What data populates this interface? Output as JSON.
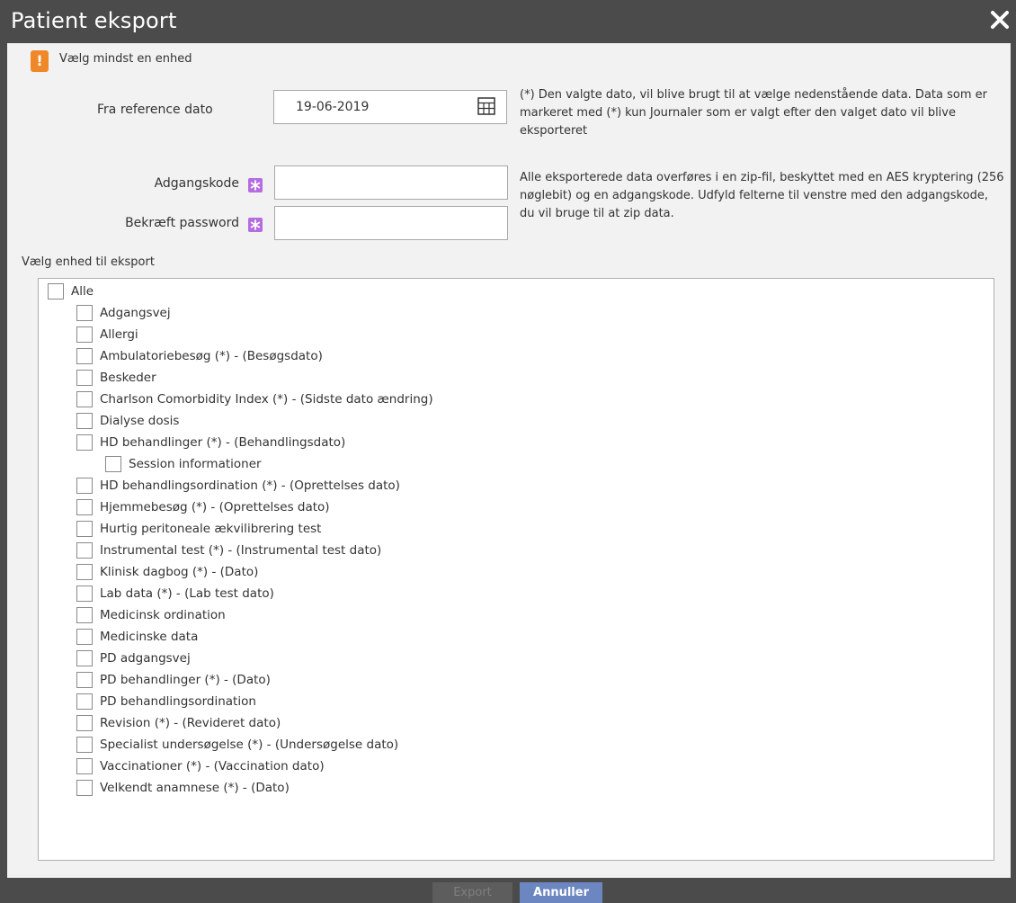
{
  "window": {
    "title": "Patient eksport"
  },
  "warning": {
    "text": "Vælg mindst en enhed"
  },
  "form": {
    "date_label": "Fra reference dato",
    "date_value": "19-06-2019",
    "date_help": "(*) Den valgte dato, vil blive brugt til at vælge nedenstående data. Data som er markeret med (*)  kun Journaler som er valgt efter den valget dato vil blive eksporteret",
    "password_label": "Adgangskode",
    "confirm_label": "Bekræft password",
    "password_help": "Alle eksporterede data overføres i en zip-fil, beskyttet med en AES kryptering (256 nøglebit) og en adgangskode. Udfyld felterne til venstre med den adgangskode, du vil bruge til at zip data."
  },
  "section_label": "Vælg enhed til eksport",
  "list": {
    "all": "Alle",
    "items": [
      "Adgangsvej",
      "Allergi",
      "Ambulatoriebesøg (*) - (Besøgsdato)",
      "Beskeder",
      "Charlson Comorbidity Index (*) - (Sidste dato ændring)",
      "Dialyse dosis",
      "HD behandlinger (*) - (Behandlingsdato)",
      "Session informationer",
      "HD behandlingsordination (*) - (Oprettelses dato)",
      "Hjemmebesøg (*) - (Oprettelses dato)",
      "Hurtig peritoneale ækvilibrering test",
      "Instrumental test (*) - (Instrumental test dato)",
      "Klinisk dagbog (*) - (Dato)",
      "Lab data (*) - (Lab test dato)",
      "Medicinsk ordination",
      "Medicinske data",
      "PD adgangsvej",
      "PD behandlinger (*) - (Dato)",
      "PD behandlingsordination",
      "Revision (*) - (Revideret dato)",
      "Specialist undersøgelse (*) - (Undersøgelse dato)",
      "Vaccinationer (*) - (Vaccination dato)",
      "Velkendt anamnese (*) - (Dato)"
    ]
  },
  "buttons": {
    "export": "Export",
    "cancel": "Annuller"
  },
  "icons": {
    "close": "close-icon",
    "warning": "warning-icon",
    "calendar": "calendar-icon",
    "required": "required-asterisk-icon"
  },
  "colors": {
    "titlebar": "#4b4b4b",
    "warning": "#f0882a",
    "required": "#b56ce0",
    "cancel_button": "#6b86c0"
  }
}
